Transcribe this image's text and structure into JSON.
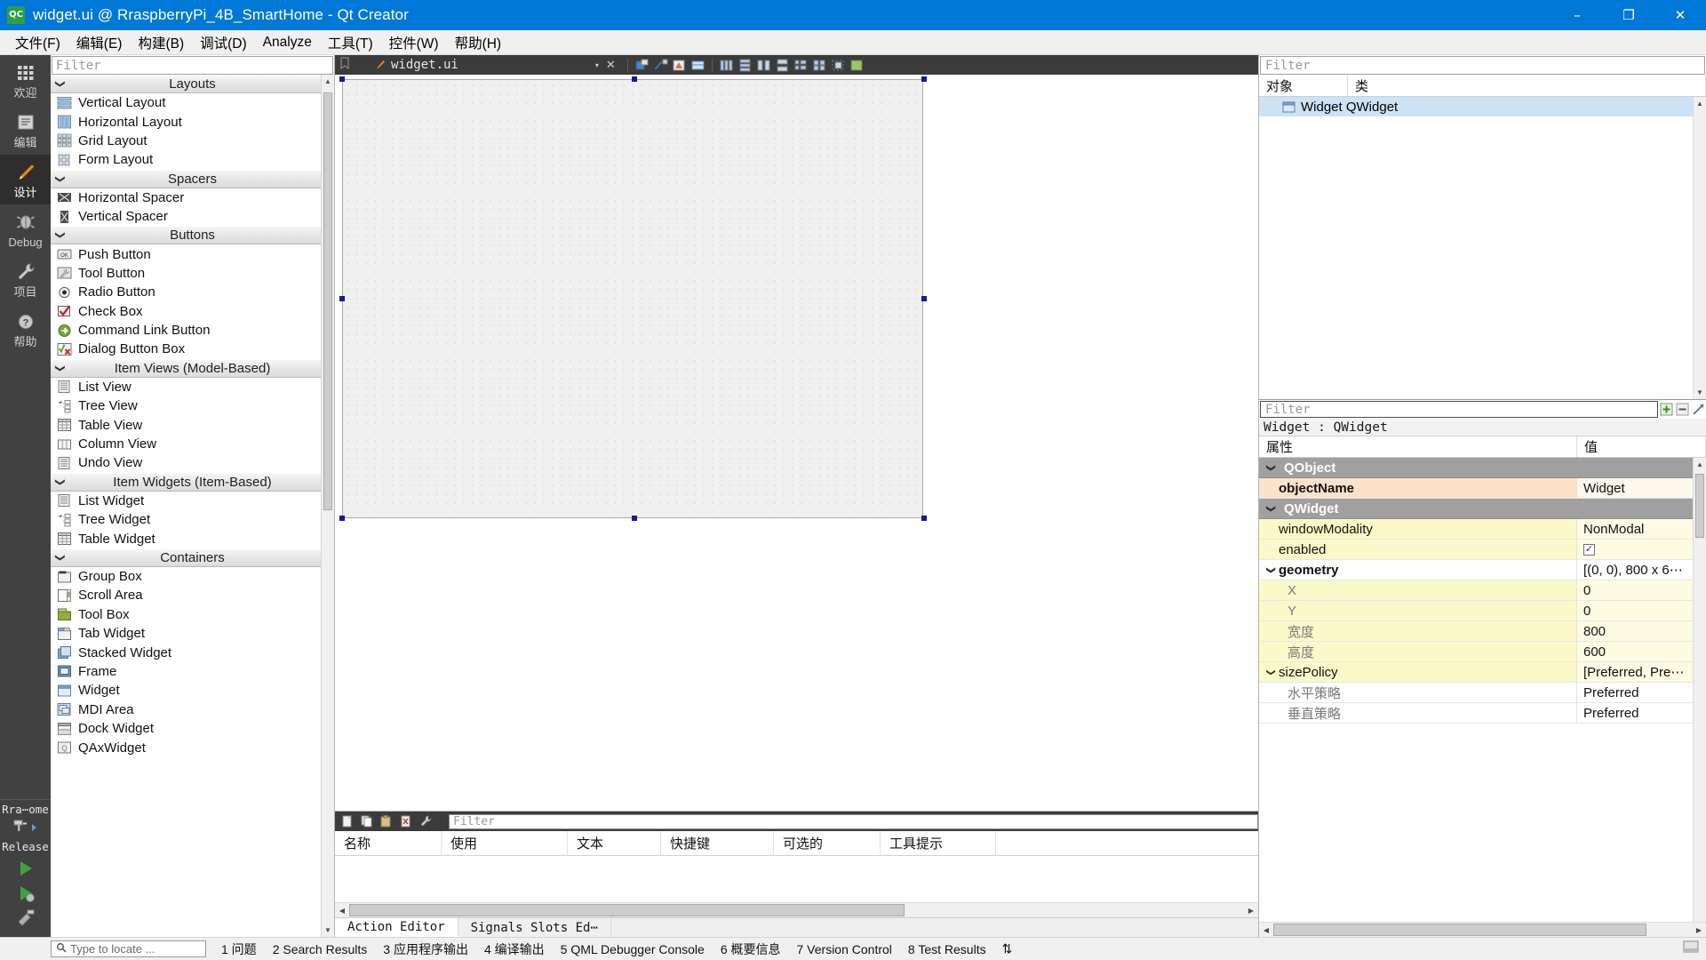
{
  "window": {
    "title": "widget.ui @ RraspberryPi_4B_SmartHome - Qt Creator",
    "logo_text": "QC",
    "minimize": "–",
    "maximize": "❐",
    "close": "✕",
    "accent_color": "#0078d7"
  },
  "menubar": {
    "items": [
      {
        "label": "文件(F)"
      },
      {
        "label": "编辑(E)"
      },
      {
        "label": "构建(B)"
      },
      {
        "label": "调试(D)"
      },
      {
        "label": "Analyze"
      },
      {
        "label": "工具(T)"
      },
      {
        "label": "控件(W)"
      },
      {
        "label": "帮助(H)"
      }
    ]
  },
  "modebar": {
    "items": [
      {
        "label": "欢迎",
        "icon": "grid-icon",
        "active": false
      },
      {
        "label": "编辑",
        "icon": "document-lines-icon",
        "active": false
      },
      {
        "label": "设计",
        "icon": "pencil-icon",
        "active": true
      },
      {
        "label": "Debug",
        "icon": "bug-icon",
        "active": false
      },
      {
        "label": "项目",
        "icon": "wrench-icon",
        "active": false
      },
      {
        "label": "帮助",
        "icon": "question-circle-icon",
        "active": false
      }
    ],
    "kit_label": "Rra⋯ome",
    "build_config": "Release",
    "run_icon": "run-play-icon",
    "debug_icon": "debug-play-icon",
    "build_icon": "build-hammer-icon"
  },
  "widget_box": {
    "filter_placeholder": "Filter",
    "groups": [
      {
        "name": "Layouts",
        "expanded": true,
        "items": [
          {
            "label": "Vertical Layout",
            "icon": "vertical-layout-icon"
          },
          {
            "label": "Horizontal Layout",
            "icon": "horizontal-layout-icon"
          },
          {
            "label": "Grid Layout",
            "icon": "grid-layout-icon"
          },
          {
            "label": "Form Layout",
            "icon": "form-layout-icon"
          }
        ]
      },
      {
        "name": "Spacers",
        "expanded": true,
        "items": [
          {
            "label": "Horizontal Spacer",
            "icon": "horizontal-spacer-icon"
          },
          {
            "label": "Vertical Spacer",
            "icon": "vertical-spacer-icon"
          }
        ]
      },
      {
        "name": "Buttons",
        "expanded": true,
        "items": [
          {
            "label": "Push Button",
            "icon": "push-button-icon"
          },
          {
            "label": "Tool Button",
            "icon": "tool-button-icon"
          },
          {
            "label": "Radio Button",
            "icon": "radio-button-icon"
          },
          {
            "label": "Check Box",
            "icon": "check-box-icon"
          },
          {
            "label": "Command Link Button",
            "icon": "command-link-icon"
          },
          {
            "label": "Dialog Button Box",
            "icon": "dialog-button-box-icon"
          }
        ]
      },
      {
        "name": "Item Views (Model-Based)",
        "expanded": true,
        "items": [
          {
            "label": "List View",
            "icon": "list-view-icon"
          },
          {
            "label": "Tree View",
            "icon": "tree-view-icon"
          },
          {
            "label": "Table View",
            "icon": "table-view-icon"
          },
          {
            "label": "Column View",
            "icon": "column-view-icon"
          },
          {
            "label": "Undo View",
            "icon": "undo-view-icon"
          }
        ]
      },
      {
        "name": "Item Widgets (Item-Based)",
        "expanded": true,
        "items": [
          {
            "label": "List Widget",
            "icon": "list-widget-icon"
          },
          {
            "label": "Tree Widget",
            "icon": "tree-widget-icon"
          },
          {
            "label": "Table Widget",
            "icon": "table-widget-icon"
          }
        ]
      },
      {
        "name": "Containers",
        "expanded": true,
        "items": [
          {
            "label": "Group Box",
            "icon": "group-box-icon"
          },
          {
            "label": "Scroll Area",
            "icon": "scroll-area-icon"
          },
          {
            "label": "Tool Box",
            "icon": "tool-box-icon"
          },
          {
            "label": "Tab Widget",
            "icon": "tab-widget-icon"
          },
          {
            "label": "Stacked Widget",
            "icon": "stacked-widget-icon"
          },
          {
            "label": "Frame",
            "icon": "frame-icon"
          },
          {
            "label": "Widget",
            "icon": "widget-icon"
          },
          {
            "label": "MDI Area",
            "icon": "mdi-area-icon"
          },
          {
            "label": "Dock Widget",
            "icon": "dock-widget-icon"
          },
          {
            "label": "QAxWidget",
            "icon": "qax-widget-icon"
          }
        ]
      }
    ]
  },
  "editor_toolbar": {
    "file_name": "widget.ui",
    "close_label": "✕",
    "dropdown_arrow": "▾"
  },
  "canvas": {
    "form_object": "Widget",
    "form_width": 800,
    "form_height": 600
  },
  "bottom_dock": {
    "filter_placeholder": "Filter",
    "columns": [
      "名称",
      "使用",
      "文本",
      "快捷键",
      "可选的",
      "工具提示"
    ],
    "rows": [],
    "tabs": [
      {
        "label": "Action Editor",
        "active": true
      },
      {
        "label": "Signals  Slots Ed⋯",
        "active": false
      }
    ]
  },
  "object_inspector": {
    "filter_placeholder": "Filter",
    "columns": [
      "对象",
      "类"
    ],
    "rows": [
      {
        "object": "Widget QWidget",
        "icon": "qwidget-icon",
        "selected": true
      }
    ]
  },
  "property_editor": {
    "filter_placeholder": "Filter",
    "object_line": "Widget : QWidget",
    "columns": [
      "属性",
      "值"
    ],
    "add_button": "+",
    "remove_button": "−",
    "config_button": "⤡",
    "rows": [
      {
        "name": "QObject",
        "value": "",
        "kind": "group",
        "expanded": true,
        "indent": 0
      },
      {
        "name": "objectName",
        "value": "Widget",
        "kind": "prop",
        "tint": "orange",
        "bold": true,
        "indent": 1
      },
      {
        "name": "QWidget",
        "value": "",
        "kind": "group",
        "expanded": true,
        "indent": 0
      },
      {
        "name": "windowModality",
        "value": "NonModal",
        "kind": "prop",
        "tint": "yellow",
        "indent": 1
      },
      {
        "name": "enabled",
        "value": "checkbox",
        "kind": "prop",
        "tint": "yellow",
        "indent": 1,
        "checked": true
      },
      {
        "name": "geometry",
        "value": "[(0, 0), 800 x 6⋯",
        "kind": "prop",
        "tint": "white",
        "bold": true,
        "indent": 0,
        "expanded": true
      },
      {
        "name": "X",
        "value": "0",
        "kind": "subprop",
        "tint": "yellow",
        "indent": 2
      },
      {
        "name": "Y",
        "value": "0",
        "kind": "subprop",
        "tint": "yellow",
        "indent": 2
      },
      {
        "name": "宽度",
        "value": "800",
        "kind": "subprop",
        "tint": "yellow",
        "indent": 2
      },
      {
        "name": "高度",
        "value": "600",
        "kind": "subprop",
        "tint": "yellow",
        "indent": 2
      },
      {
        "name": "sizePolicy",
        "value": "[Preferred, Pre⋯",
        "kind": "prop",
        "tint": "yellow",
        "indent": 0,
        "expanded": true
      },
      {
        "name": "水平策略",
        "value": "Preferred",
        "kind": "subprop",
        "tint": "white",
        "indent": 2
      },
      {
        "name": "垂直策略",
        "value": "Preferred",
        "kind": "subprop",
        "tint": "white",
        "indent": 2
      }
    ]
  },
  "statusbar": {
    "locator_placeholder": "Type to locate ...",
    "panes": [
      {
        "num": "1",
        "label": "问题"
      },
      {
        "num": "2",
        "label": "Search Results"
      },
      {
        "num": "3",
        "label": "应用程序输出"
      },
      {
        "num": "4",
        "label": "编译输出"
      },
      {
        "num": "5",
        "label": "QML Debugger Console"
      },
      {
        "num": "6",
        "label": "概要信息"
      },
      {
        "num": "7",
        "label": "Version Control"
      },
      {
        "num": "8",
        "label": "Test Results"
      }
    ],
    "resize_glyph": "⇅"
  }
}
